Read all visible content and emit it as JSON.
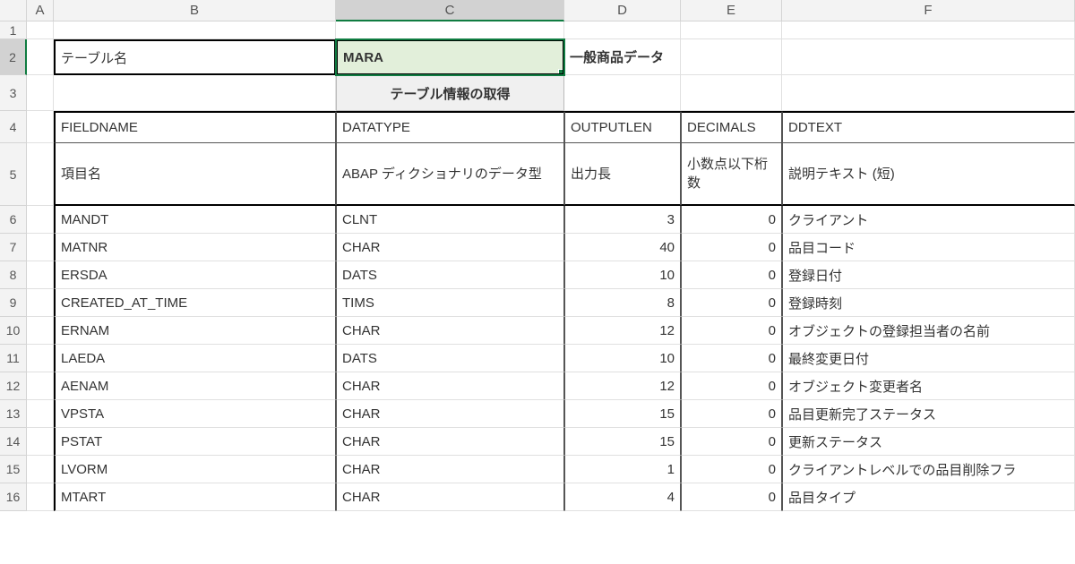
{
  "columns": [
    "A",
    "B",
    "C",
    "D",
    "E",
    "F"
  ],
  "selected_column_index": 2,
  "selected_row": 2,
  "row_numbers": [
    1,
    2,
    3,
    4,
    5,
    6,
    7,
    8,
    9,
    10,
    11,
    12,
    13,
    14,
    15,
    16
  ],
  "header": {
    "table_name_label": "テーブル名",
    "table_name_value": "MARA",
    "table_desc": "一般商品データ",
    "button_label": "テーブル情報の取得"
  },
  "field_headers": {
    "fieldname": "FIELDNAME",
    "datatype": "DATATYPE",
    "outputlen": "OUTPUTLEN",
    "decimals": "DECIMALS",
    "ddtext": "DDTEXT"
  },
  "field_headers_jp": {
    "fieldname": "項目名",
    "datatype": "ABAP ディクショナリのデータ型",
    "outputlen": "出力長",
    "decimals": "小数点以下桁数",
    "ddtext": "説明テキスト (短)"
  },
  "rows": [
    {
      "fieldname": "MANDT",
      "datatype": "CLNT",
      "outputlen": "3",
      "decimals": "0",
      "ddtext": "クライアント"
    },
    {
      "fieldname": "MATNR",
      "datatype": "CHAR",
      "outputlen": "40",
      "decimals": "0",
      "ddtext": "品目コード"
    },
    {
      "fieldname": "ERSDA",
      "datatype": "DATS",
      "outputlen": "10",
      "decimals": "0",
      "ddtext": "登録日付"
    },
    {
      "fieldname": "CREATED_AT_TIME",
      "datatype": "TIMS",
      "outputlen": "8",
      "decimals": "0",
      "ddtext": "登録時刻"
    },
    {
      "fieldname": "ERNAM",
      "datatype": "CHAR",
      "outputlen": "12",
      "decimals": "0",
      "ddtext": "オブジェクトの登録担当者の名前"
    },
    {
      "fieldname": "LAEDA",
      "datatype": "DATS",
      "outputlen": "10",
      "decimals": "0",
      "ddtext": "最終変更日付"
    },
    {
      "fieldname": "AENAM",
      "datatype": "CHAR",
      "outputlen": "12",
      "decimals": "0",
      "ddtext": "オブジェクト変更者名"
    },
    {
      "fieldname": "VPSTA",
      "datatype": "CHAR",
      "outputlen": "15",
      "decimals": "0",
      "ddtext": "品目更新完了ステータス"
    },
    {
      "fieldname": "PSTAT",
      "datatype": "CHAR",
      "outputlen": "15",
      "decimals": "0",
      "ddtext": "更新ステータス"
    },
    {
      "fieldname": "LVORM",
      "datatype": "CHAR",
      "outputlen": "1",
      "decimals": "0",
      "ddtext": "クライアントレベルでの品目削除フラ"
    },
    {
      "fieldname": "MTART",
      "datatype": "CHAR",
      "outputlen": "4",
      "decimals": "0",
      "ddtext": "品目タイプ"
    }
  ]
}
